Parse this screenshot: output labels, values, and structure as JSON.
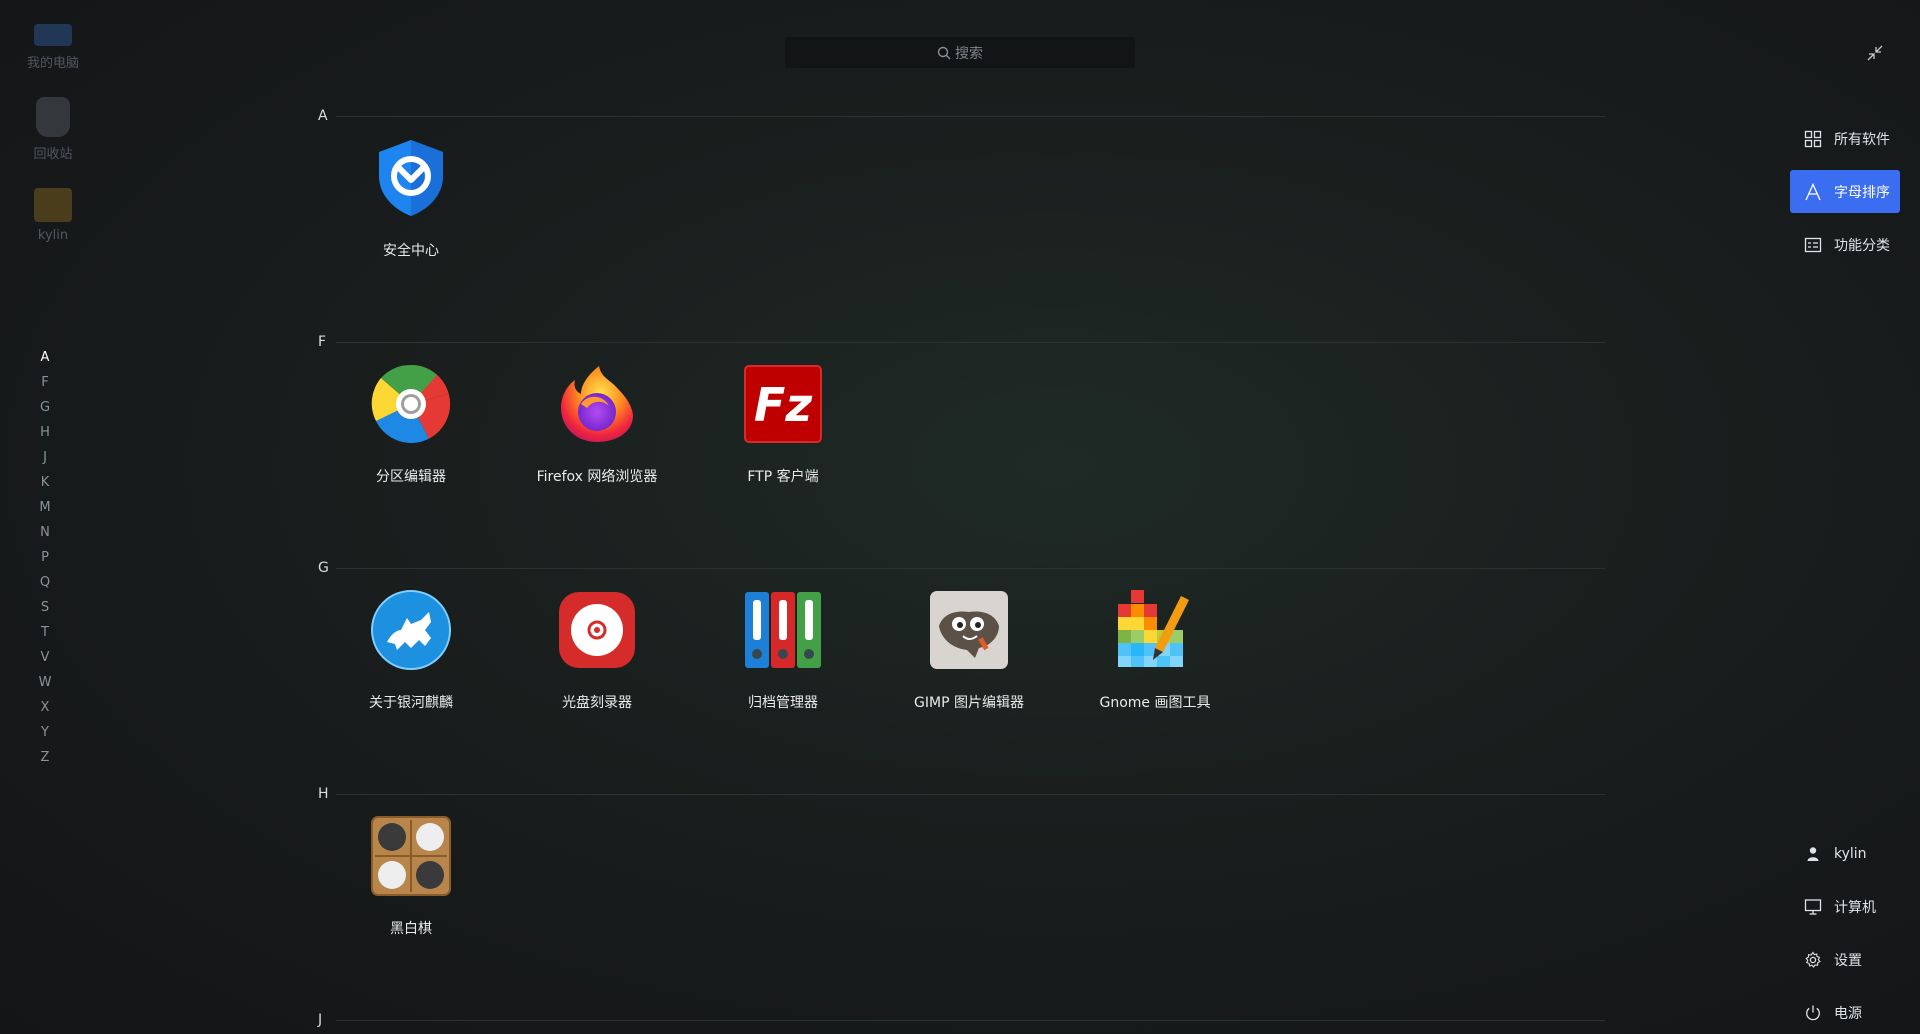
{
  "desktop": {
    "icons": [
      {
        "label": "我的电脑",
        "icon": "computer-icon"
      },
      {
        "label": "回收站",
        "icon": "trash-icon"
      },
      {
        "label": "kylin",
        "icon": "folder-icon"
      }
    ]
  },
  "search": {
    "placeholder": "搜索"
  },
  "letter_nav": [
    "A",
    "F",
    "G",
    "H",
    "J",
    "K",
    "M",
    "N",
    "P",
    "Q",
    "S",
    "T",
    "V",
    "W",
    "X",
    "Y",
    "Z"
  ],
  "letter_nav_active": "A",
  "sections": [
    {
      "letter": "A",
      "apps": [
        {
          "name": "安全中心",
          "icon": "security-center-icon"
        }
      ]
    },
    {
      "letter": "F",
      "apps": [
        {
          "name": "分区编辑器",
          "icon": "partition-editor-icon"
        },
        {
          "name": "Firefox 网络浏览器",
          "icon": "firefox-icon"
        },
        {
          "name": "FTP 客户端",
          "icon": "filezilla-icon"
        }
      ]
    },
    {
      "letter": "G",
      "apps": [
        {
          "name": "关于银河麒麟",
          "icon": "about-kylin-icon"
        },
        {
          "name": "光盘刻录器",
          "icon": "disc-burner-icon"
        },
        {
          "name": "归档管理器",
          "icon": "archive-manager-icon"
        },
        {
          "name": "GIMP 图片编辑器",
          "icon": "gimp-icon"
        },
        {
          "name": "Gnome 画图工具",
          "icon": "gnome-paint-icon"
        }
      ]
    },
    {
      "letter": "H",
      "apps": [
        {
          "name": "黑白棋",
          "icon": "reversi-icon"
        }
      ]
    },
    {
      "letter": "J",
      "apps": []
    }
  ],
  "right_panel": {
    "all_software": "所有软件",
    "alphabetical": "字母排序",
    "category": "功能分类",
    "user": "kylin",
    "computer": "计算机",
    "settings": "设置",
    "power": "电源"
  },
  "colors": {
    "accent": "#3b6df0",
    "background": "#16181a"
  }
}
